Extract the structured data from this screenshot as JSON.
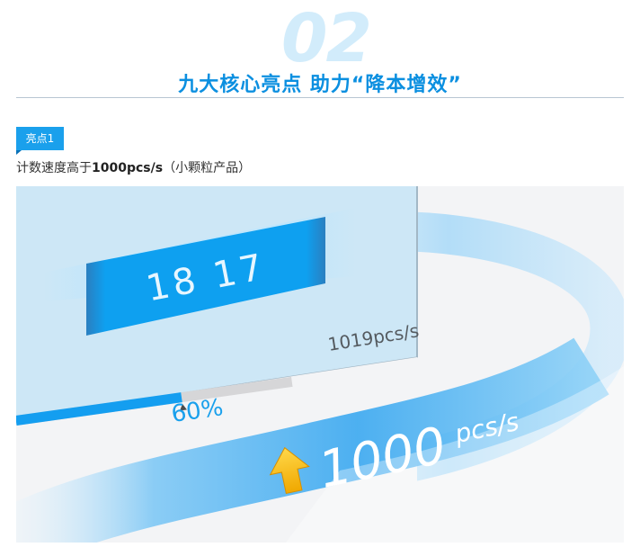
{
  "section": {
    "number": "02",
    "title": "九大核心亮点 助力“降本增效”"
  },
  "highlight": {
    "badge": "亮点1",
    "text_prefix": "计数速度高于",
    "text_bold": "1000pcs/s",
    "text_suffix": "（小颗粒产品）"
  },
  "screen": {
    "counter": "18 17",
    "speed_label": "1019pcs/s",
    "progress_percent": 60,
    "progress_label": "60%"
  },
  "banner": {
    "speed_number": "1000",
    "speed_unit": "pcs/s"
  },
  "colors": {
    "accent": "#1aa0ec",
    "title": "#0b8fe0",
    "lcd": "#0e9ff0",
    "arrow": "#f5b800"
  },
  "icons": [
    "up-arrow-icon"
  ]
}
